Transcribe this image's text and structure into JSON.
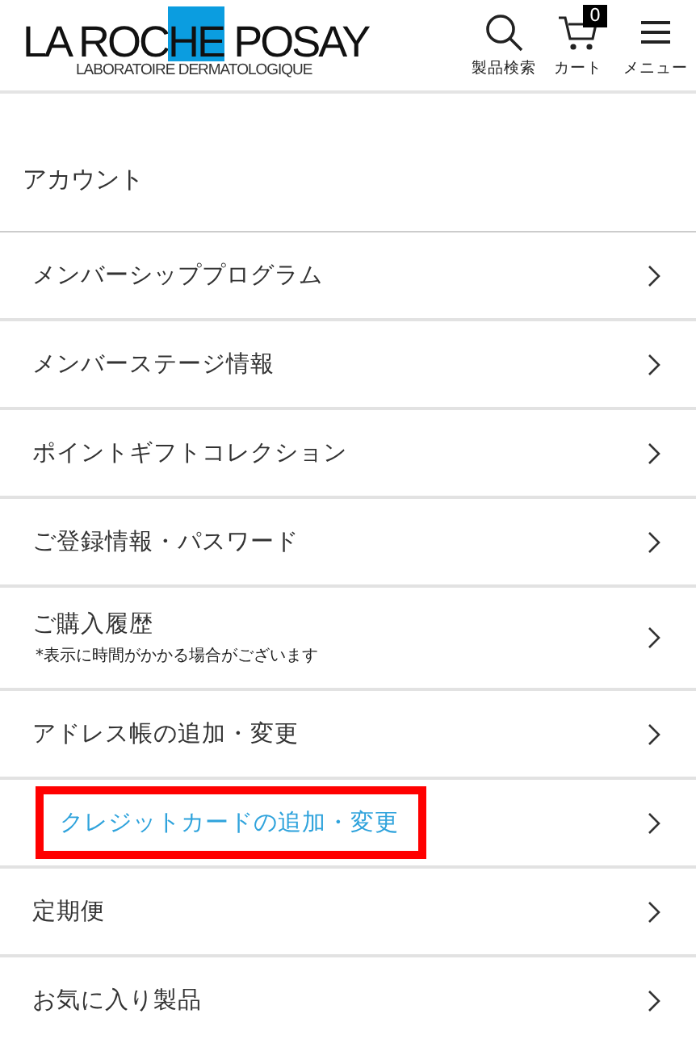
{
  "header": {
    "logo": {
      "parts": [
        "LA ROC",
        "HE",
        " POSAY"
      ],
      "tagline": "LABORATOIRE DERMATOLOGIQUE"
    },
    "actions": [
      {
        "kind": "search",
        "label": "製品検索"
      },
      {
        "kind": "cart",
        "label": "カート",
        "count": "0"
      },
      {
        "kind": "menu",
        "label": "メニュー"
      }
    ]
  },
  "title": "アカウント",
  "items": [
    {
      "label": "メンバーシッププログラム",
      "highlighted": false
    },
    {
      "label": "メンバーステージ情報",
      "highlighted": false
    },
    {
      "label": "ポイントギフトコレクション",
      "highlighted": false
    },
    {
      "label": "ご登録情報・パスワード",
      "highlighted": false
    },
    {
      "label": "ご購入履歴",
      "note": "*表示に時間がかかる場合がございます",
      "highlighted": false
    },
    {
      "label": "アドレス帳の追加・変更",
      "highlighted": false
    },
    {
      "label": "クレジットカードの追加・変更",
      "highlighted": true
    },
    {
      "label": "定期便",
      "highlighted": false
    },
    {
      "label": "お気に入り製品",
      "highlighted": false
    }
  ]
}
